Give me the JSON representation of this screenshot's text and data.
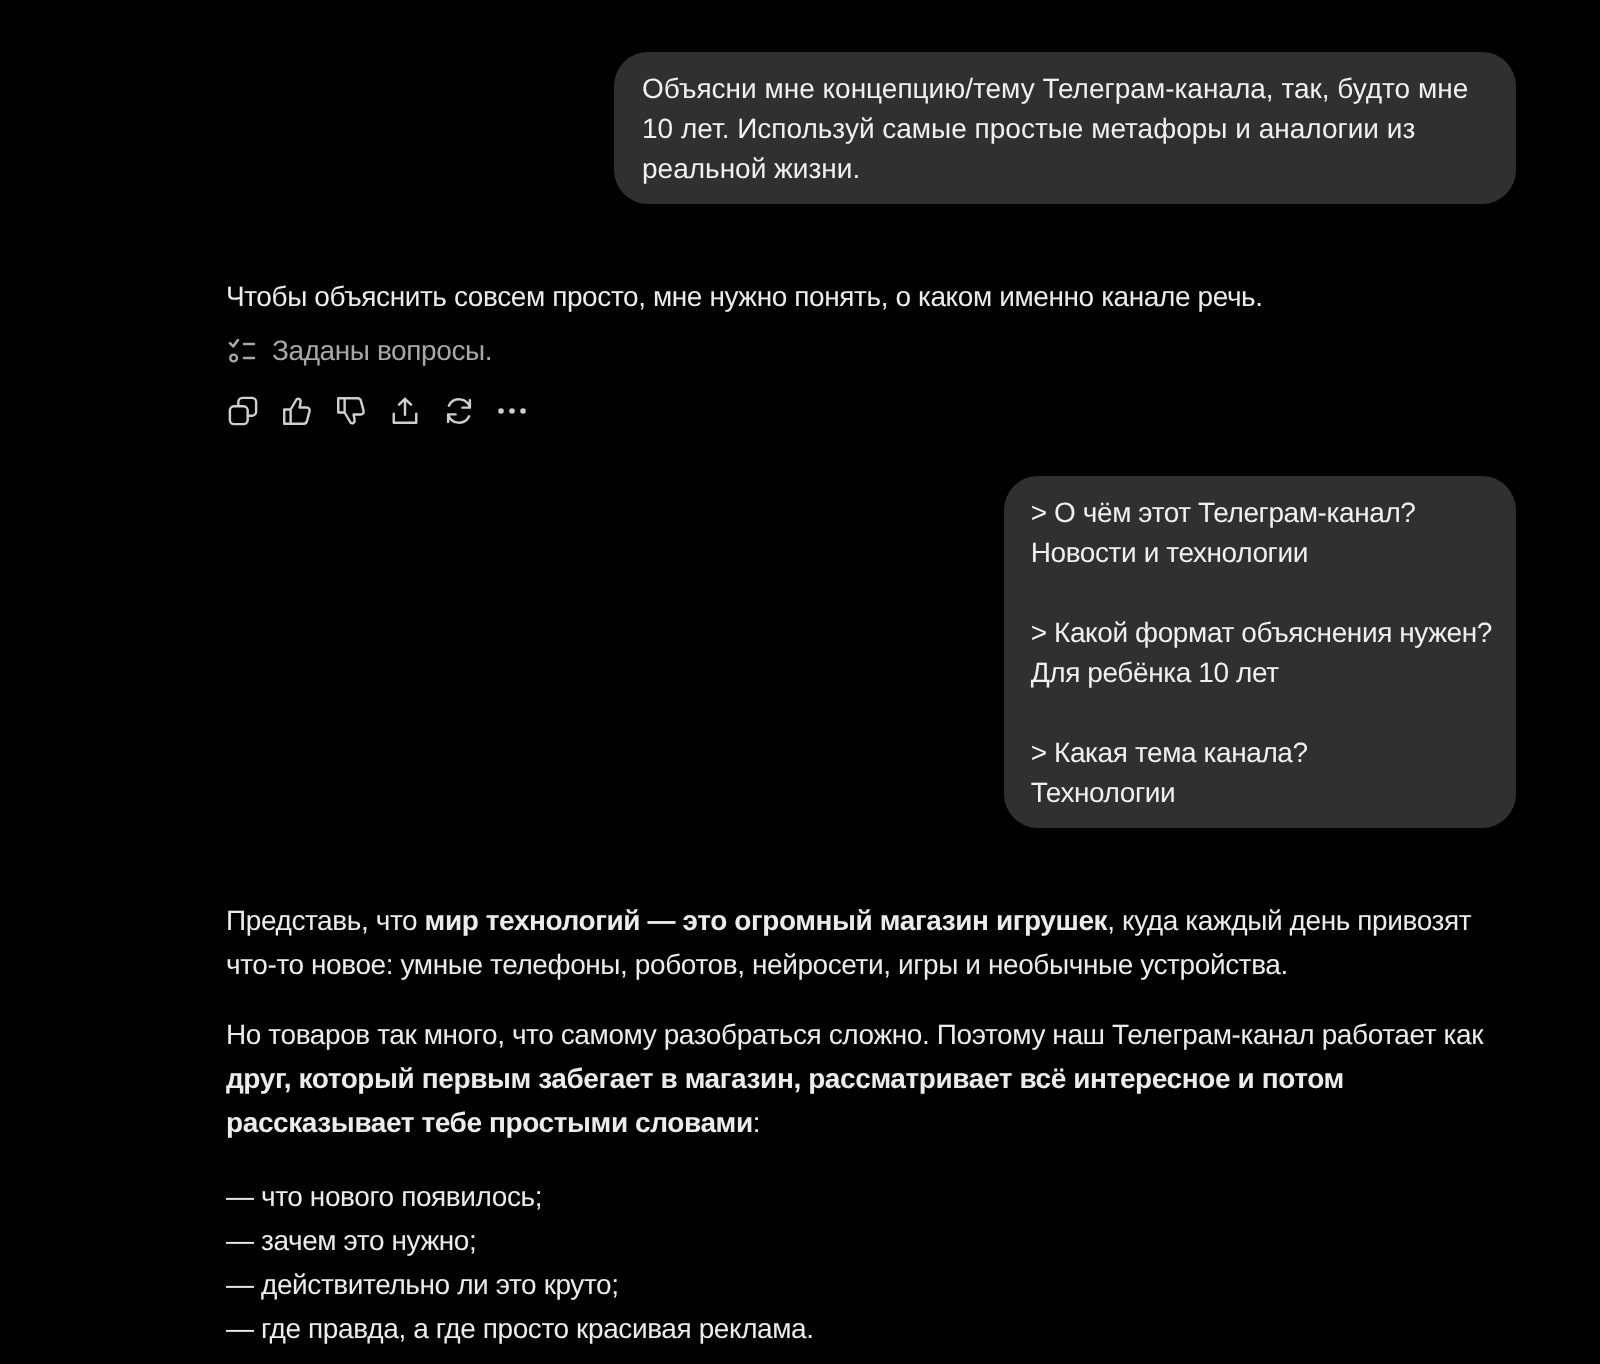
{
  "messages": [
    {
      "kind": "user",
      "text": "Объясни мне концепцию/тему Телеграм-канала, так, будто мне 10 лет. Используй самые простые метафоры и аналогии из реальной жизни."
    },
    {
      "kind": "assistant",
      "blocks": [
        {
          "kind": "paragraph",
          "text": "Чтобы объяснить совсем просто, мне нужно понять, о каком именно канале речь."
        }
      ],
      "status": "Заданы вопросы.",
      "action_bar": true
    },
    {
      "kind": "user",
      "answers": [
        {
          "question": "> О чём этот Телеграм-канал?",
          "answer": "Новости и технологии"
        },
        {
          "question": "> Какой формат объяснения нужен?",
          "answer": "Для ребёнка 10 лет"
        },
        {
          "question": "> Какая тема канала?",
          "answer": "Технологии"
        }
      ]
    },
    {
      "kind": "assistant",
      "blocks": [
        {
          "kind": "paragraph",
          "text": "Представь, что **мир технологий — это огромный магазин игрушек**, куда каждый день привозят что-то новое: умные телефоны, роботов, нейросети, игры и необычные устройства."
        },
        {
          "kind": "paragraph",
          "text": "Но товаров так много, что самому разобраться сложно. Поэтому наш Телеграм-канал работает как **друг, который первым забегает в магазин, рассматривает всё интересное и потом рассказывает тебе простыми словами**:"
        },
        {
          "kind": "list",
          "items": [
            "— что нового появилось;",
            "— зачем это нужно;",
            "— действительно ли это круто;",
            "— где правда, а где просто красивая реклама."
          ]
        }
      ],
      "action_bar": false
    }
  ]
}
